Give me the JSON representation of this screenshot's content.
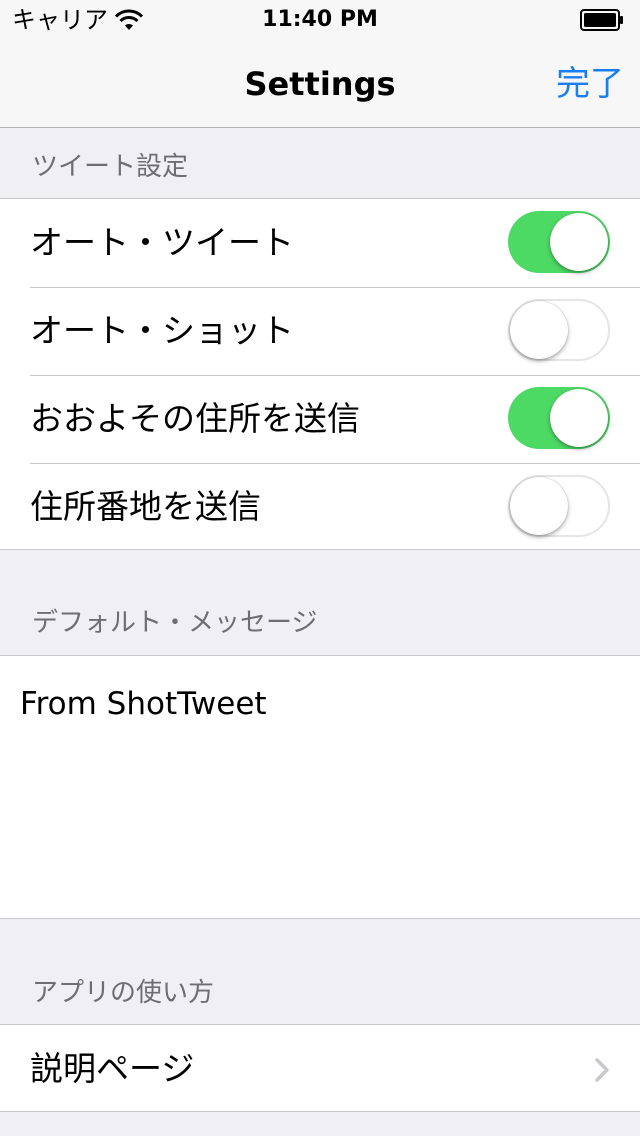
{
  "status_bar": {
    "carrier": "キャリア",
    "time": "11:40 PM",
    "icons": [
      "wifi-icon",
      "battery-icon"
    ]
  },
  "nav_bar": {
    "title": "Settings",
    "done_label": "完了"
  },
  "tweet_settings": {
    "header": "ツイート設定",
    "items": [
      {
        "label": "オート・ツイート",
        "on": true
      },
      {
        "label": "オート・ショット",
        "on": false
      },
      {
        "label": "おおよその住所を送信",
        "on": true
      },
      {
        "label": "住所番地を送信",
        "on": false
      }
    ]
  },
  "default_message": {
    "header": "デフォルト・メッセージ",
    "value": "From ShotTweet"
  },
  "app_usage": {
    "header": "アプリの使い方",
    "items": [
      {
        "label": "説明ページ",
        "icon": "chevron-right-icon"
      }
    ]
  },
  "colors": {
    "accent": "#1b7ef0",
    "switch_on": "#4cd964",
    "background": "#efeff4",
    "header_text": "#6d6d72"
  }
}
